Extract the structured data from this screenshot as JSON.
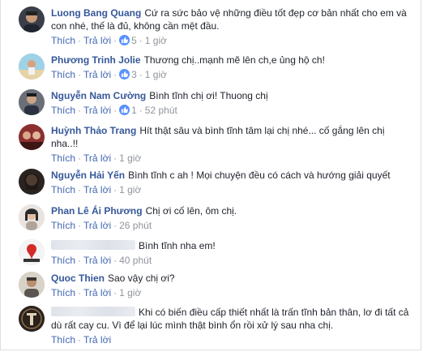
{
  "labels": {
    "like": "Thích",
    "reply": "Trả lời",
    "dot": "·"
  },
  "comments": [
    {
      "avatar": "avatar-man-dark",
      "name": "Luong Bang Quang",
      "text": "Cứ ra sức bảo vệ những điều tốt đẹp cơ bản nhất cho em và con nhé, thế là đủ, không cần mệt đầu.",
      "reactions": "5",
      "time": "1 giờ"
    },
    {
      "avatar": "avatar-woman-beach",
      "name": "Phương Trinh Jolie",
      "text": "Thương chị..mạnh mẽ lên ch,e ủng hộ ch!",
      "reactions": "3",
      "time": "1 giờ"
    },
    {
      "avatar": "avatar-man-suit",
      "name": "Nguyễn Nam Cường",
      "text": "Bình tĩnh chị ơi! Thuong chị",
      "reactions": "1",
      "time": "52 phút"
    },
    {
      "avatar": "avatar-woman-group",
      "name": "Huỳnh Thảo Trang",
      "text": "Hít thật sâu và bình tĩnh tâm lại chị nhé... cố gắng lên chị nha..!!",
      "reactions": "",
      "time": "1 giờ"
    },
    {
      "avatar": "avatar-woman-dark",
      "name": "Nguyễn Hải Yến",
      "text": "Bình tĩnh c ah ! Mọi chuyện đều có cách và hướng giải quyết",
      "reactions": "",
      "time": "1 giờ"
    },
    {
      "avatar": "avatar-woman-light",
      "name": "Phan Lê Ái Phương",
      "text": "Chị ơi cố lên, ôm chị.",
      "reactions": "",
      "time": "26 phút"
    },
    {
      "avatar": "avatar-red-logo",
      "name": "",
      "text": "Bình tĩnh nha em!",
      "reactions": "",
      "time": "40 phút"
    },
    {
      "avatar": "avatar-man-grey",
      "name": "Quoc Thien",
      "text": "Sao vậy chị ơi?",
      "reactions": "",
      "time": "1 giờ"
    },
    {
      "avatar": "avatar-dark-emblem",
      "name": "",
      "text": "Khi có biến điều cấp thiết nhất là trấn tĩnh bản thân, lơ đi tất cả dù rất cay cu. Vì để lại lúc mình thật bình ổn rồi xử lý sau nha chị.",
      "reactions": "",
      "time": ""
    }
  ]
}
